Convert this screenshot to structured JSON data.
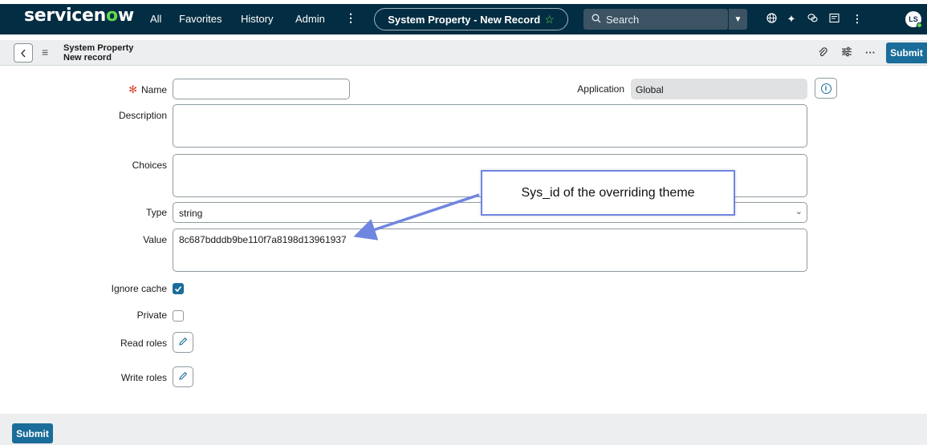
{
  "colors": {
    "nav_bg": "#032d42",
    "accent": "#1a6d9a",
    "brand_green": "#62d84e",
    "required": "#d9422b",
    "callout_border": "#6f86e0"
  },
  "nav": {
    "logo_prefix": "servicen",
    "logo_o": "o",
    "logo_suffix": "w",
    "items": [
      "All",
      "Favorites",
      "History",
      "Admin"
    ],
    "more_icon": "vertical-dots-icon",
    "context_title": "System Property - New Record",
    "context_star": "☆",
    "search_placeholder": "Search",
    "right_icons": [
      "globe-icon",
      "sparkle-icon",
      "chat-icon",
      "inbox-icon",
      "vertical-dots-icon"
    ],
    "avatar_initials": "LS"
  },
  "header": {
    "title_line1": "System Property",
    "title_line2": "New record",
    "submit_label": "Submit",
    "icons": [
      "paperclip-icon",
      "sliders-icon",
      "ellipsis-icon"
    ]
  },
  "form": {
    "name_label": "Name",
    "name_value": "",
    "application_label": "Application",
    "application_value": "Global",
    "description_label": "Description",
    "description_value": "",
    "choices_label": "Choices",
    "choices_value": "",
    "type_label": "Type",
    "type_value": "string",
    "value_label": "Value",
    "value_value": "8c687bdddb9be110f7a8198d13961937",
    "ignore_cache_label": "Ignore cache",
    "ignore_cache_checked": true,
    "private_label": "Private",
    "private_checked": false,
    "read_roles_label": "Read roles",
    "write_roles_label": "Write roles"
  },
  "callout": {
    "text": "Sys_id of the overriding theme"
  },
  "footer": {
    "submit_label": "Submit"
  }
}
